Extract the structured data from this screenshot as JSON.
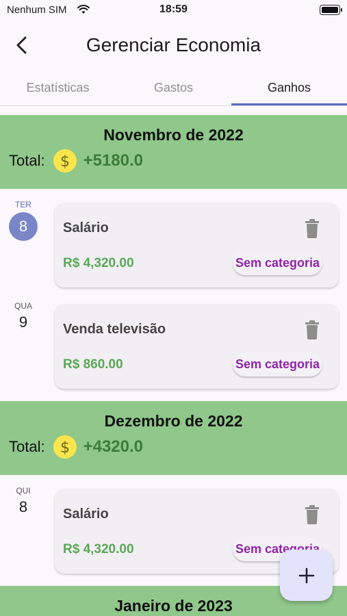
{
  "status_bar": {
    "carrier": "Nenhum SIM",
    "time": "18:59"
  },
  "app_bar": {
    "title": "Gerenciar Economia"
  },
  "tabs": [
    {
      "label": "Estatísticas",
      "active": false
    },
    {
      "label": "Gastos",
      "active": false
    },
    {
      "label": "Ganhos",
      "active": true
    }
  ],
  "months": [
    {
      "title": "Novembro de 2022",
      "total_label": "Total:",
      "total_value": "+5180.0",
      "entries": [
        {
          "weekday": "TER",
          "day": "8",
          "today": true,
          "title": "Salário",
          "amount": "R$ 4,320.00",
          "category": "Sem categoria"
        },
        {
          "weekday": "QUA",
          "day": "9",
          "today": false,
          "title": "Venda televisão",
          "amount": "R$ 860.00",
          "category": "Sem categoria"
        }
      ]
    },
    {
      "title": "Dezembro de 2022",
      "total_label": "Total:",
      "total_value": "+4320.0",
      "entries": [
        {
          "weekday": "QUI",
          "day": "8",
          "today": false,
          "title": "Salário",
          "amount": "R$ 4,320.00",
          "category": "Sem categoria"
        }
      ]
    },
    {
      "title": "Janeiro de 2023"
    }
  ],
  "fab": {
    "label": "+"
  },
  "colors": {
    "month_header_bg": "#90c78b",
    "accent": "#5c6bc0",
    "amount_green": "#5aa757",
    "category_purple": "#8e24aa",
    "coin_yellow": "#fde64b"
  }
}
